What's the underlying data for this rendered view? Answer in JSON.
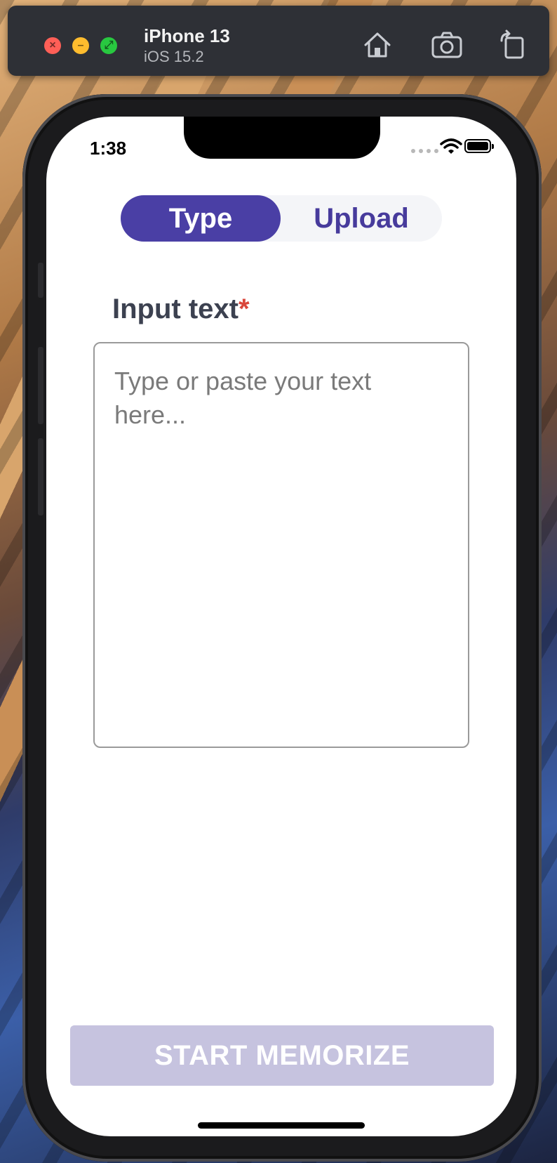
{
  "simulator": {
    "device_name": "iPhone 13",
    "os_version": "iOS 15.2",
    "icons": [
      "close-icon",
      "minimize-icon",
      "fullscreen-icon",
      "home-icon",
      "screenshot-icon",
      "rotate-icon"
    ]
  },
  "status_bar": {
    "time": "1:38",
    "icons": [
      "cellular-icon",
      "wifi-icon",
      "battery-icon"
    ]
  },
  "mode_toggle": {
    "options": [
      {
        "label": "Type",
        "selected": true
      },
      {
        "label": "Upload",
        "selected": false
      }
    ]
  },
  "form": {
    "label": "Input text",
    "required_marker": "*",
    "input": {
      "value": "",
      "placeholder": "Type or paste your text here..."
    }
  },
  "actions": {
    "start_label": "START MEMORIZE"
  },
  "colors": {
    "accent": "#4a3fa5",
    "accent_text": "#473b9c",
    "button_disabled": "#c6c3df",
    "required": "#d9463b",
    "label": "#3c4150"
  }
}
